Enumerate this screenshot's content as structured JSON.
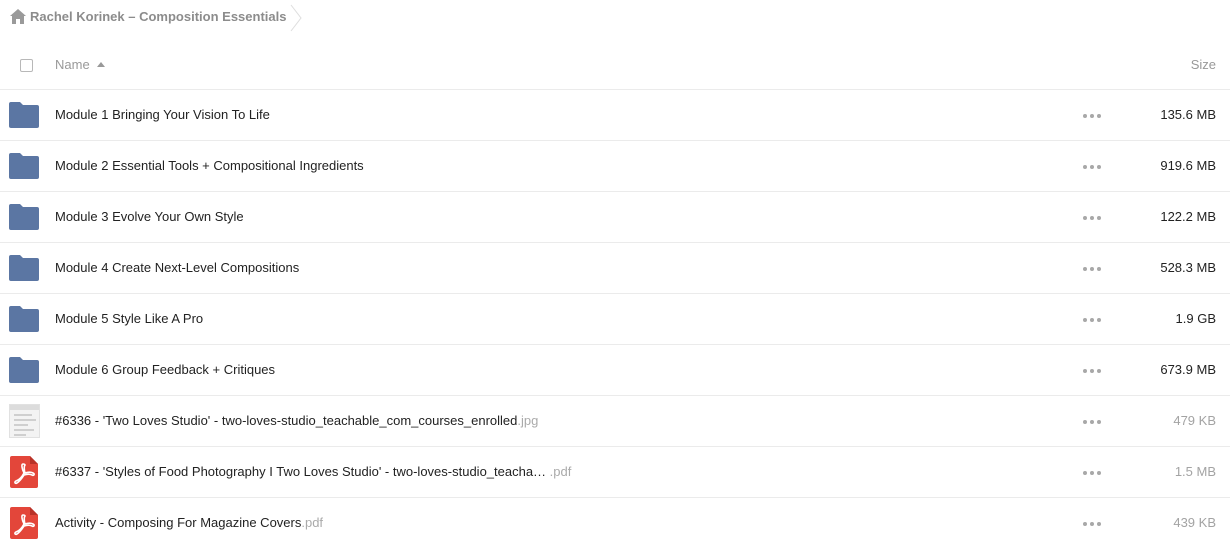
{
  "breadcrumb": {
    "icon": "home-icon",
    "label": "Rachel Korinek – Composition Essentials"
  },
  "header": {
    "name_label": "Name",
    "size_label": "Size"
  },
  "colors": {
    "folder": "#5b76a3",
    "pdf": "#e3463a",
    "muted": "#a3a3a3",
    "divider": "#ebebeb"
  },
  "rows": [
    {
      "type": "folder",
      "name": "Module 1 Bringing Your Vision To Life",
      "ext": "",
      "size": "135.6 MB"
    },
    {
      "type": "folder",
      "name": "Module 2 Essential Tools + Compositional Ingredients",
      "ext": "",
      "size": "919.6 MB"
    },
    {
      "type": "folder",
      "name": "Module 3 Evolve Your Own Style",
      "ext": "",
      "size": "122.2 MB"
    },
    {
      "type": "folder",
      "name": "Module 4 Create Next-Level Compositions",
      "ext": "",
      "size": "528.3 MB"
    },
    {
      "type": "folder",
      "name": "Module 5 Style Like A Pro",
      "ext": "",
      "size": "1.9 GB"
    },
    {
      "type": "folder",
      "name": "Module 6 Group Feedback + Critiques",
      "ext": "",
      "size": "673.9 MB"
    },
    {
      "type": "image",
      "name": "#6336 - 'Two Loves Studio' - two-loves-studio_teachable_com_courses_enrolled",
      "ext": ".jpg",
      "size": "479 KB"
    },
    {
      "type": "pdf",
      "name": "#6337 - 'Styles of Food Photography I Two Loves Studio' - two-loves-studio_teacha… ",
      "ext": ".pdf",
      "size": "1.5 MB"
    },
    {
      "type": "pdf",
      "name": "Activity - Composing For Magazine Covers",
      "ext": ".pdf",
      "size": "439 KB"
    }
  ]
}
